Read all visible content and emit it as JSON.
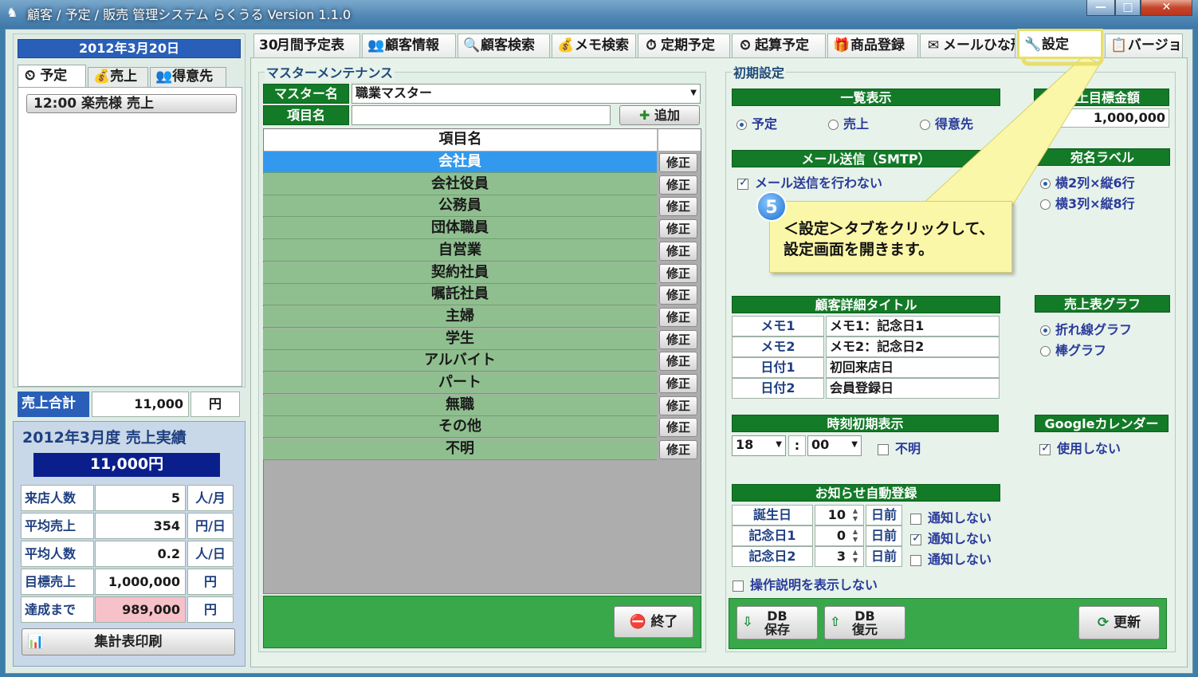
{
  "window": {
    "title": "顧客 / 予定 / 販売 管理システム らくうる  Version 1.1.0",
    "min": "—",
    "max": "□",
    "close": "✕"
  },
  "left": {
    "date": "2012年3月20日",
    "tabs": [
      "予定",
      "売上",
      "得意先"
    ],
    "schedule_item": "12:00 楽売様 売上",
    "sales_total_label": "売上合計",
    "sales_total_value": "11,000",
    "sales_total_unit": "円",
    "monthly_title": "2012年3月度  売上実績",
    "monthly_amount": "11,000円",
    "stats": [
      {
        "label": "来店人数",
        "value": "5",
        "unit": "人/月"
      },
      {
        "label": "平均売上",
        "value": "354",
        "unit": "円/日"
      },
      {
        "label": "平均人数",
        "value": "0.2",
        "unit": "人/日"
      },
      {
        "label": "目標売上",
        "value": "1,000,000",
        "unit": "円"
      },
      {
        "label": "達成まで",
        "value": "989,000",
        "unit": "円"
      }
    ],
    "print_btn": "集計表印刷"
  },
  "tabs": [
    "月間予定表",
    "顧客情報",
    "顧客検索",
    "メモ検索",
    "定期予定",
    "起算予定",
    "商品登録",
    "メールひな形",
    "設定",
    "バージョン"
  ],
  "tab_icons": [
    "30",
    "👥",
    "🔍",
    "💰",
    "⏱",
    "⏲",
    "🎁",
    "✉",
    "🔧",
    "📋"
  ],
  "master": {
    "section_title": "マスターメンテナンス",
    "master_name_label": "マスター名",
    "master_name_value": "職業マスター",
    "item_name_label": "項目名",
    "item_name_value": "",
    "add_btn": "追加",
    "column_header": "項目名",
    "rows": [
      "会社員",
      "会社役員",
      "公務員",
      "団体職員",
      "自営業",
      "契約社員",
      "嘱託社員",
      "主婦",
      "学生",
      "アルバイト",
      "パート",
      "無職",
      "その他",
      "不明"
    ],
    "fix_label": "修正",
    "end_btn": "終了"
  },
  "init": {
    "section_title": "初期設定",
    "list_display": {
      "title": "一覧表示",
      "options": [
        "予定",
        "売上",
        "得意先"
      ]
    },
    "sales_target": {
      "title": "売上目標金額",
      "value": "1,000,000"
    },
    "mail": {
      "title": "メール送信（SMTP）",
      "checkbox": "メール送信を行わない"
    },
    "label": {
      "title": "宛名ラベル",
      "options": [
        "横2列×縦6行",
        "横3列×縦8行"
      ]
    },
    "callout": {
      "number": "5",
      "line1": "＜設定＞タブをクリックして、",
      "line2": "設定画面を開きます。"
    },
    "detail": {
      "title": "顧客詳細タイトル",
      "rows": [
        {
          "k": "メモ1",
          "v": "メモ1：記念日1"
        },
        {
          "k": "メモ2",
          "v": "メモ2：記念日2"
        },
        {
          "k": "日付1",
          "v": "初回来店日"
        },
        {
          "k": "日付2",
          "v": "会員登録日"
        }
      ]
    },
    "graph": {
      "title": "売上表グラフ",
      "options": [
        "折れ線グラフ",
        "棒グラフ"
      ]
    },
    "time": {
      "title": "時刻初期表示",
      "hour": "18",
      "sep": ":",
      "minute": "00",
      "unknown": "不明"
    },
    "google": {
      "title": "Googleカレンダー",
      "checkbox": "使用しない"
    },
    "notice": {
      "title": "お知らせ自動登録",
      "rows": [
        {
          "k": "誕生日",
          "n": "10",
          "d": "日前",
          "c": "通知しない"
        },
        {
          "k": "記念日1",
          "n": "0",
          "d": "日前",
          "c": "通知しない"
        },
        {
          "k": "記念日2",
          "n": "3",
          "d": "日前",
          "c": "通知しない"
        }
      ]
    },
    "help_checkbox": "操作説明を表示しない",
    "db_save": [
      "DB",
      "保存"
    ],
    "db_restore": [
      "DB",
      "復元"
    ],
    "update_btn": "更新"
  }
}
